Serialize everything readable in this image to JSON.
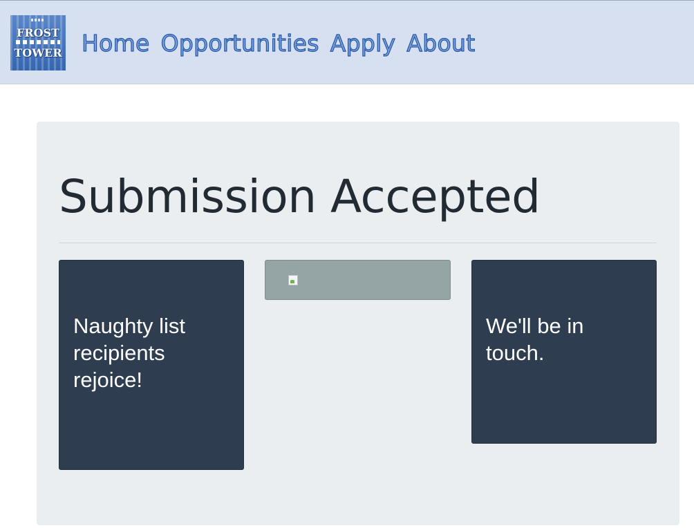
{
  "logo": {
    "line1": "FROST",
    "line2": "TOWER"
  },
  "nav": {
    "items": [
      "Home",
      "Opportunities",
      "Apply",
      "About"
    ]
  },
  "main": {
    "title": "Submission Accepted",
    "cards": [
      {
        "text": "Naughty list recipients rejoice!"
      },
      {
        "text": "We'll be in touch."
      }
    ],
    "image_icon": "broken-image-icon"
  },
  "colors": {
    "navbar_bg": "#d6e0f0",
    "nav_link": "#2356a8",
    "card_bg": "#2e3d4f",
    "image_box_bg": "#95a5a6"
  }
}
